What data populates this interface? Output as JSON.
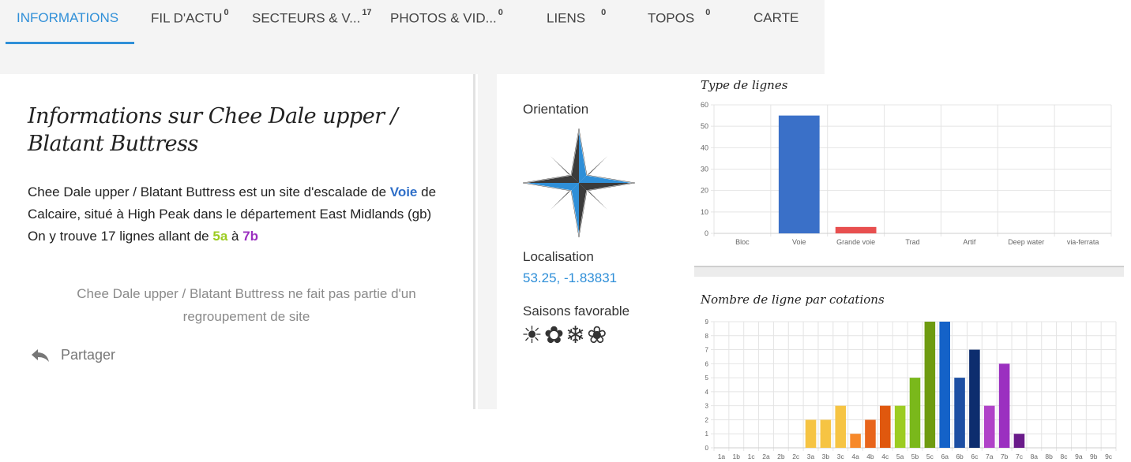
{
  "tabs": [
    {
      "label": "INFORMATIONS",
      "count": "",
      "active": true
    },
    {
      "label": "FIL D'ACTU",
      "count": "0"
    },
    {
      "label": "SECTEURS & V...",
      "count": "17"
    },
    {
      "label": "PHOTOS & VID...",
      "count": "0"
    },
    {
      "label": "LIENS",
      "count": "0"
    },
    {
      "label": "TOPOS",
      "count": "0"
    },
    {
      "label": "CARTE",
      "count": ""
    }
  ],
  "info": {
    "title": "Informations sur Chee Dale upper / Blatant Buttress",
    "desc_part1": "Chee Dale upper / Blatant Buttress est un site d'escalade de ",
    "desc_type": "Voie",
    "desc_part2": " de Calcaire, situé à High Peak dans le département East Midlands (gb)",
    "desc_line2_part1": "On y trouve 17 lignes allant de ",
    "grade_min": "5a",
    "desc_line2_mid": " à ",
    "grade_max": "7b",
    "regroup": "Chee Dale upper / Blatant Buttress ne fait pas partie d'un regroupement de site",
    "share_label": "Partager"
  },
  "side": {
    "orientation_label": "Orientation",
    "location_label": "Localisation",
    "coords": "53.25, -1.83831",
    "seasons_label": "Saisons favorable"
  },
  "colors": {
    "accent": "#2f8fd8",
    "grade_5": "#9ccc21",
    "grade_7": "#9b30c0"
  },
  "chart_data": [
    {
      "type": "bar",
      "title": "Type de lignes",
      "categories": [
        "Bloc",
        "Voie",
        "Grande voie",
        "Trad",
        "Artif",
        "Deep water",
        "via-ferrata"
      ],
      "values": [
        0,
        55,
        3,
        0,
        0,
        0,
        0
      ],
      "colors": [
        "#3a70c8",
        "#3a70c8",
        "#e84f4f",
        "#3a70c8",
        "#3a70c8",
        "#3a70c8",
        "#3a70c8"
      ],
      "ylim": [
        0,
        60
      ],
      "yticks": [
        0,
        10,
        20,
        30,
        40,
        50,
        60
      ],
      "grid": true
    },
    {
      "type": "bar",
      "title": "Nombre de ligne par cotations",
      "categories": [
        "1a",
        "1b",
        "1c",
        "2a",
        "2b",
        "2c",
        "3a",
        "3b",
        "3c",
        "4a",
        "4b",
        "4c",
        "5a",
        "5b",
        "5c",
        "6a",
        "6b",
        "6c",
        "7a",
        "7b",
        "7c",
        "8a",
        "8b",
        "8c",
        "9a",
        "9b",
        "9c"
      ],
      "values": [
        0,
        0,
        0,
        0,
        0,
        0,
        2,
        2,
        3,
        1,
        2,
        3,
        3,
        5,
        9,
        9,
        5,
        7,
        3,
        6,
        1,
        0,
        0,
        0,
        0,
        0,
        0
      ],
      "colors": [
        "#f6c443",
        "#f6c443",
        "#f6c443",
        "#f6c443",
        "#f6c443",
        "#f6c443",
        "#f6c443",
        "#f6c443",
        "#f6c443",
        "#f7892a",
        "#e8641b",
        "#e0580e",
        "#9ccc21",
        "#7ab81b",
        "#6e9b10",
        "#1462c8",
        "#1d4fa3",
        "#0d2d6e",
        "#b042c8",
        "#9b30c0",
        "#6a1b8a",
        "#888",
        "#888",
        "#888",
        "#888",
        "#888",
        "#888"
      ],
      "ylim": [
        0,
        9
      ],
      "yticks": [
        0,
        1,
        2,
        3,
        4,
        5,
        6,
        7,
        8,
        9
      ],
      "grid": true
    }
  ]
}
